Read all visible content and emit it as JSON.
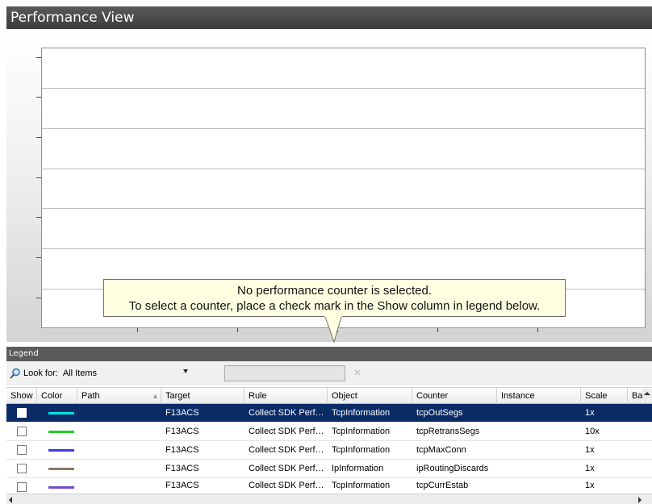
{
  "window": {
    "title": "Performance View"
  },
  "chart": {
    "message_line1": "No performance counter is selected.",
    "message_line2": "To select a counter, place a check mark in the Show column in legend below."
  },
  "legend": {
    "header": "Legend",
    "look_for_label": "Look for:",
    "look_for_value": "All Items",
    "search_value": "",
    "clear_icon": "×"
  },
  "table": {
    "columns": [
      "Show",
      "Color",
      "Path",
      "Target",
      "Rule",
      "Object",
      "Counter",
      "Instance",
      "Scale",
      "Ba"
    ],
    "rows": [
      {
        "color": "#00e5e5",
        "path": "",
        "target": "F13ACS",
        "rule": "Collect SDK Perf…",
        "object": "TcpInformation",
        "counter": "tcpOutSegs",
        "instance": "",
        "scale": "1x",
        "selected": true
      },
      {
        "color": "#22cc22",
        "path": "",
        "target": "F13ACS",
        "rule": "Collect SDK Perf…",
        "object": "TcpInformation",
        "counter": "tcpRetransSegs",
        "instance": "",
        "scale": "10x",
        "selected": false
      },
      {
        "color": "#3a3ae0",
        "path": "",
        "target": "F13ACS",
        "rule": "Collect SDK Perf…",
        "object": "TcpInformation",
        "counter": "tcpMaxConn",
        "instance": "",
        "scale": "1x",
        "selected": false
      },
      {
        "color": "#8b7a62",
        "path": "",
        "target": "F13ACS",
        "rule": "Collect SDK Perf…",
        "object": "IpInformation",
        "counter": "ipRoutingDiscards",
        "instance": "",
        "scale": "1x",
        "selected": false
      },
      {
        "color": "#6c4fd0",
        "path": "",
        "target": "F13ACS",
        "rule": "Collect SDK Perf…",
        "object": "TcpInformation",
        "counter": "tcpCurrEstab",
        "instance": "",
        "scale": "1x",
        "selected": false
      }
    ]
  }
}
